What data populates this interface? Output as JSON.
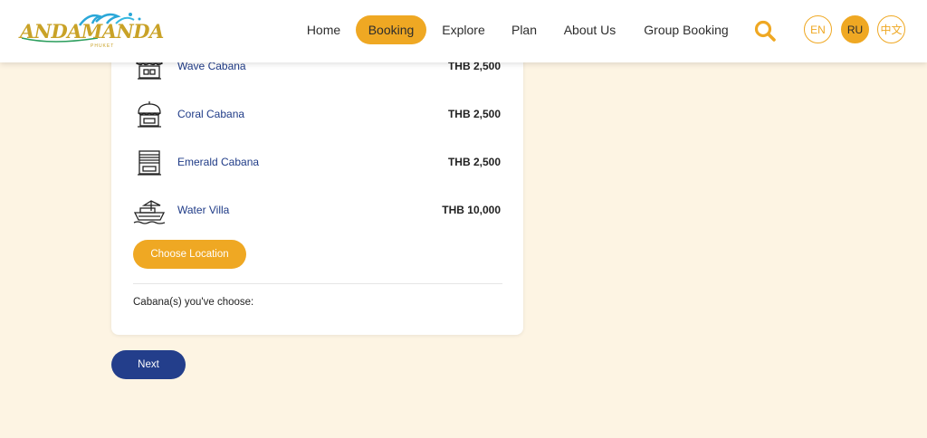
{
  "header": {
    "logo_text": "ANDAMANDA",
    "logo_sub": "PHUKET",
    "nav": [
      {
        "label": "Home",
        "active": false
      },
      {
        "label": "Booking",
        "active": true
      },
      {
        "label": "Explore",
        "active": false
      },
      {
        "label": "Plan",
        "active": false
      },
      {
        "label": "About Us",
        "active": false
      },
      {
        "label": "Group Booking",
        "active": false
      }
    ],
    "search_icon": "search-icon",
    "languages": [
      {
        "label": "EN",
        "active": false
      },
      {
        "label": "RU",
        "active": true
      },
      {
        "label": "中文",
        "active": false
      }
    ]
  },
  "cabanas": [
    {
      "name": "Wave Cabana",
      "price": "THB 2,500",
      "icon": "cabana-awning-icon"
    },
    {
      "name": "Coral Cabana",
      "price": "THB 2,500",
      "icon": "cabana-dome-icon"
    },
    {
      "name": "Emerald Cabana",
      "price": "THB 2,500",
      "icon": "cabana-shutter-icon"
    },
    {
      "name": "Water Villa",
      "price": "THB 10,000",
      "icon": "boat-icon"
    }
  ],
  "choose_location_label": "Choose Location",
  "chosen_label": "Cabana(s) you've choose:",
  "next_label": "Next",
  "colors": {
    "accent": "#efa823",
    "primary": "#233e8b",
    "link": "#1f3b87",
    "background": "#fdf4e3"
  }
}
